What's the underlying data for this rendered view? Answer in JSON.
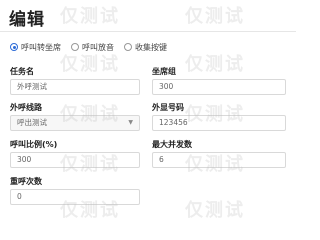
{
  "dialog": {
    "title": "编辑"
  },
  "mode": {
    "options": [
      "呼叫转坐席",
      "呼叫放音",
      "收集按键"
    ],
    "selected_index": 0
  },
  "fields": {
    "task_name": {
      "label": "任务名",
      "value": "外呼测试"
    },
    "agent_group": {
      "label": "坐席组",
      "value": "300"
    },
    "outbound_line": {
      "label": "外呼线路",
      "value": "呼出测试"
    },
    "display_number": {
      "label": "外显号码",
      "value": "123456"
    },
    "call_ratio": {
      "label": "呼叫比例(%)",
      "value": "300"
    },
    "max_concurrency": {
      "label": "最大并发数",
      "value": "6"
    },
    "redial_count": {
      "label": "重呼次数",
      "value": "0"
    }
  },
  "watermark": {
    "text": "仅测试"
  },
  "colors": {
    "accent": "#2d6bd6",
    "border": "#d9d9d9"
  },
  "icons": {
    "select_caret": "chevron-down-icon"
  }
}
